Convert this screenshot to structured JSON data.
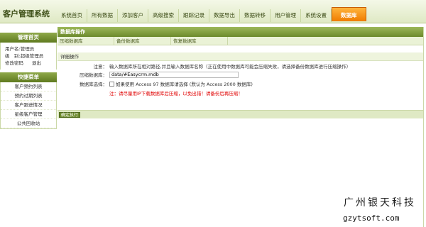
{
  "app": {
    "title": "客户管理系统"
  },
  "nav": {
    "items": [
      "系统首页",
      "所有数据",
      "添加客户",
      "高级搜索",
      "跟踪记录",
      "数据导出",
      "数据转移",
      "用户管理",
      "系统设置",
      "数据库"
    ],
    "active": "数据库"
  },
  "sidebar": {
    "header": "管理首页",
    "user_line": "用户名:管理员",
    "role_line": "级　别:超级管理员",
    "change_password": "修改密码",
    "logout": "退出",
    "menu_header": "快捷菜单",
    "menu_items": [
      "客户预约列表",
      "预约过期列表",
      "客户跟进情况",
      "星级客户管理",
      "公共回收站"
    ]
  },
  "main": {
    "panel_title": "数据库操作",
    "tabs": [
      "压缩数据库",
      "备份数据库",
      "恢复数据库"
    ],
    "section_title": "详细操作",
    "note_label": "注意：",
    "note_text": "输入数据库所在相对路径,并且输入数据库名称（正在使用中数据库可能会压缩失败，请选择备份数据库进行压缩操作）",
    "db_label": "压缩数据库：",
    "db_value": "data/#Easycrm.mdb",
    "db_select_label": "数据库选择：",
    "checkbox_text": "如果使用 Access 97 数据库请选择 (默认为 Access 2000 数据库)",
    "warning": "注：请尽量用IP下载数据库后压缩，以免出错！请备份后再压缩！",
    "submit_label": "确定执行"
  },
  "watermark": {
    "cn": "广州银天科技",
    "en": "gzytsoft.com"
  }
}
